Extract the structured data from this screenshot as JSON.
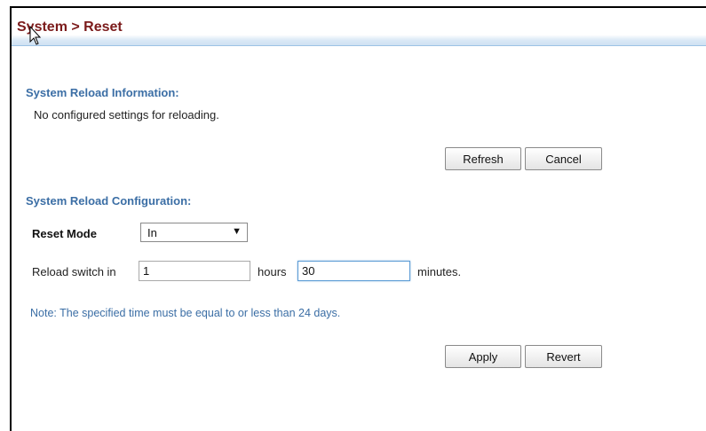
{
  "header": {
    "title": "System > Reset"
  },
  "reload_info": {
    "title": "System Reload Information:",
    "message": "No configured settings for reloading.",
    "refresh_label": "Refresh",
    "cancel_label": "Cancel"
  },
  "reload_config": {
    "title": "System Reload Configuration:",
    "reset_mode_label": "Reset Mode",
    "reset_mode_value": "In",
    "reload_prefix": "Reload switch in",
    "hours_value": "1",
    "hours_label": "hours",
    "minutes_value": "30",
    "minutes_label": "minutes.",
    "note": "Note: The specified time must be equal to or less than 24 days.",
    "apply_label": "Apply",
    "revert_label": "Revert"
  },
  "icons": {
    "dropdown": "chevron-down-icon",
    "cursor": "mouse-cursor-icon"
  },
  "colors": {
    "title": "#7b1b1b",
    "section": "#3b6ea5",
    "header_band": "#cfe1f2"
  }
}
